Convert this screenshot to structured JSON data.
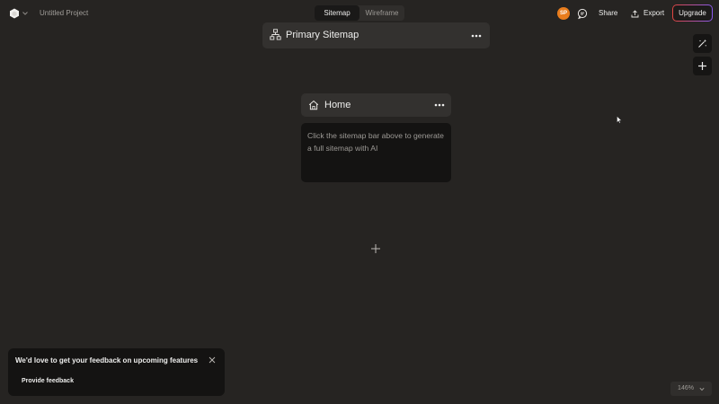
{
  "project": {
    "name": "Untitled Project"
  },
  "tabs": [
    {
      "label": "Sitemap",
      "active": true
    },
    {
      "label": "Wireframe",
      "active": false
    }
  ],
  "user": {
    "initials": "SP",
    "avatar_color": "#e97d1d"
  },
  "header_actions": {
    "share_label": "Share",
    "export_label": "Export",
    "upgrade_label": "Upgrade"
  },
  "sitemap": {
    "title": "Primary Sitemap",
    "page": {
      "title": "Home",
      "hint": "Click the sitemap bar above to generate a full sitemap with AI"
    }
  },
  "feedback": {
    "message": "We'd love to get your feedback on upcoming features",
    "button_label": "Provide feedback"
  },
  "zoom": {
    "level": "146%"
  },
  "icons": [
    "app-logo-icon",
    "chevron-down-icon",
    "comment-icon",
    "export-icon",
    "magic-wand-icon",
    "plus-icon",
    "sitemap-icon",
    "more-icon",
    "home-icon",
    "close-icon"
  ],
  "colors": {
    "background": "#262422",
    "accent_orange": "#e97d1d",
    "upgrade_gradient_start": "#e0453f",
    "upgrade_gradient_end": "#8a5cf0"
  }
}
